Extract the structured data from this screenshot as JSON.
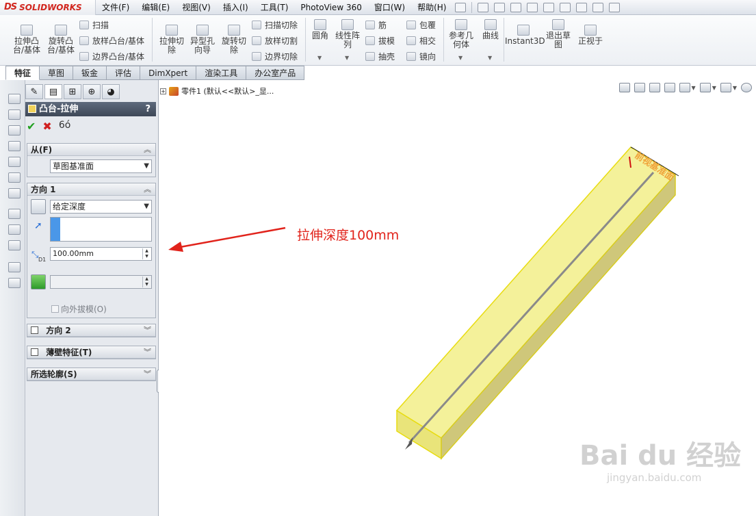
{
  "app": {
    "brand_prefix": "DS",
    "brand_name": "SOLIDWORKS"
  },
  "menu": [
    "文件(F)",
    "编辑(E)",
    "视图(V)",
    "插入(I)",
    "工具(T)",
    "PhotoView 360",
    "窗口(W)",
    "帮助(H)"
  ],
  "ribbon": {
    "extrude_boss": "拉伸凸台/基体",
    "revolve_boss": "旋转凸台/基体",
    "sweep": "扫描",
    "loft_boss": "放样凸台/基体",
    "boundary_boss": "边界凸台/基体",
    "extrude_cut": "拉伸切除",
    "hole_wizard": "异型孔向导",
    "revolve_cut": "旋转切除",
    "sweep_cut": "扫描切除",
    "loft_cut": "放样切割",
    "boundary_cut": "边界切除",
    "fillet": "圆角",
    "linear_pattern": "线性阵列",
    "rib": "筋",
    "draft": "拔模",
    "shell": "抽壳",
    "wrap": "包覆",
    "intersect": "相交",
    "mirror": "镜向",
    "reference_geometry": "参考几何体",
    "curves": "曲线",
    "instant3d": "Instant3D",
    "exit_sketch": "退出草图",
    "normal_to": "正视于"
  },
  "tabs": [
    "特征",
    "草图",
    "钣金",
    "评估",
    "DimXpert",
    "渲染工具",
    "办公室产品"
  ],
  "active_tab": "特征",
  "property_manager": {
    "title": "凸台-拉伸",
    "help": "?",
    "from": {
      "header": "从(F)",
      "start_condition": "草图基准面"
    },
    "direction1": {
      "header": "方向 1",
      "end_condition": "给定深度",
      "depth": "100.00mm",
      "depth_label": "D1",
      "draft_outward": "向外拔模(O)"
    },
    "direction2": {
      "header": "方向 2"
    },
    "thin_feature": {
      "header": "薄壁特征(T)"
    },
    "selected_contours": {
      "header": "所选轮廓(S)"
    }
  },
  "viewport": {
    "tree_node": "零件1  (默认<<默认>_显...",
    "annotation": "拉伸深度100mm",
    "dimension_label": "前视基准面",
    "watermark_main": "Bai du 经验",
    "watermark_sub": "jingyan.baidu.com"
  },
  "colors": {
    "annotation": "#e1231b",
    "body_fill": "#f3f08a",
    "body_edge": "#e6d800",
    "accent": "#d2261e"
  }
}
